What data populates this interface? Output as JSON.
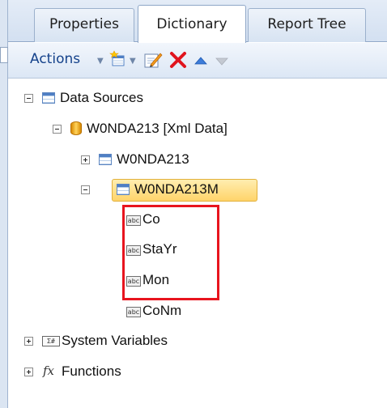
{
  "tabs": [
    {
      "label": "Properties",
      "active": false
    },
    {
      "label": "Dictionary",
      "active": true
    },
    {
      "label": "Report Tree",
      "active": false
    }
  ],
  "toolbar": {
    "actions_label": "Actions",
    "buttons": [
      "new-item-icon",
      "edit-icon",
      "delete-icon",
      "move-up-icon",
      "move-down-icon"
    ]
  },
  "tree": {
    "data_sources": "Data Sources",
    "xml_source": "W0NDA213 [Xml Data]",
    "table1": "W0NDA213",
    "table2": "W0NDA213M",
    "columns": [
      "Co",
      "StaYr",
      "Mon",
      "CoNm"
    ],
    "system_variables": "System Variables",
    "functions": "Functions"
  },
  "colors": {
    "selection": "#ffd46a",
    "highlight_box": "#e8141e",
    "delete_icon": "#e0141e",
    "tab_border": "#8fa7c7"
  }
}
